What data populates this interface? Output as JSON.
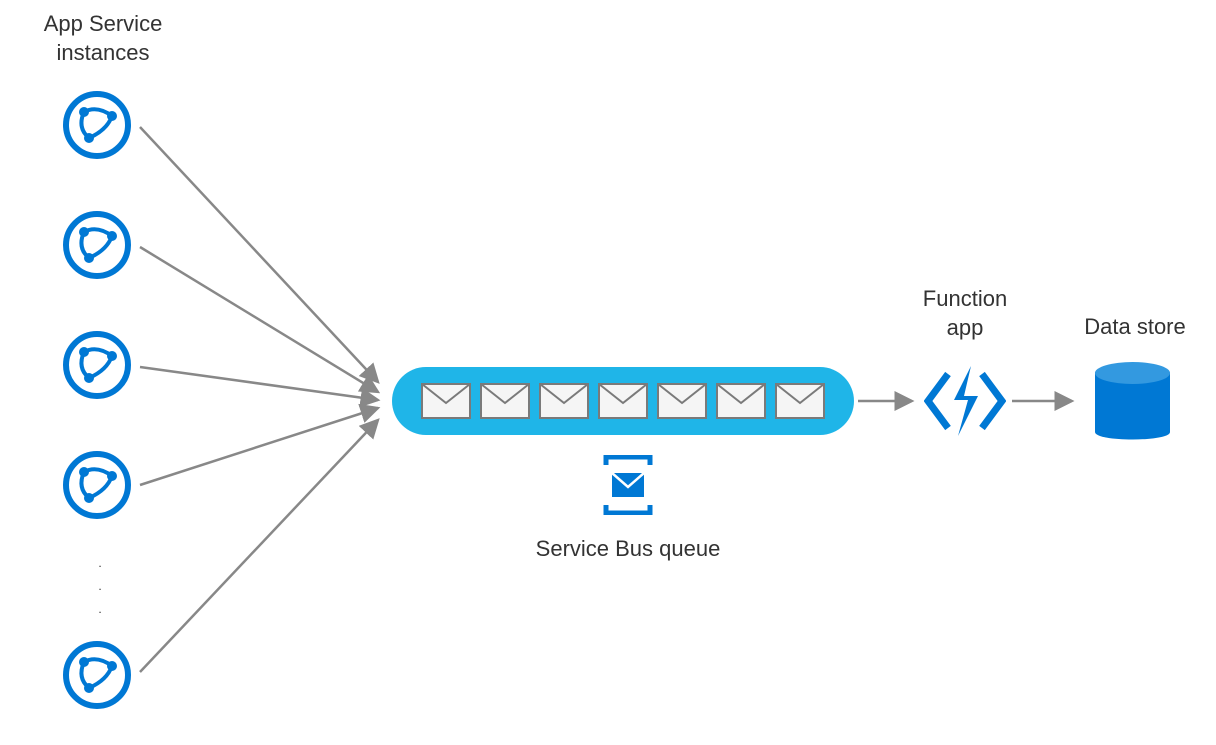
{
  "labels": {
    "app_service": "App Service instances",
    "function_app": "Function app",
    "data_store": "Data store",
    "service_bus": "Service Bus queue"
  },
  "colors": {
    "azure_blue": "#0078d4",
    "queue_pill": "#1fb5e8",
    "arrow": "#888888",
    "envelope_stroke": "#7a7a7a",
    "envelope_fill": "#f5f5f5"
  },
  "diagram": {
    "app_service_instances_shown": 5,
    "ellipsis": true,
    "queue_message_count": 7,
    "flow": [
      "App Service instances",
      "Service Bus queue",
      "Function app",
      "Data store"
    ]
  }
}
